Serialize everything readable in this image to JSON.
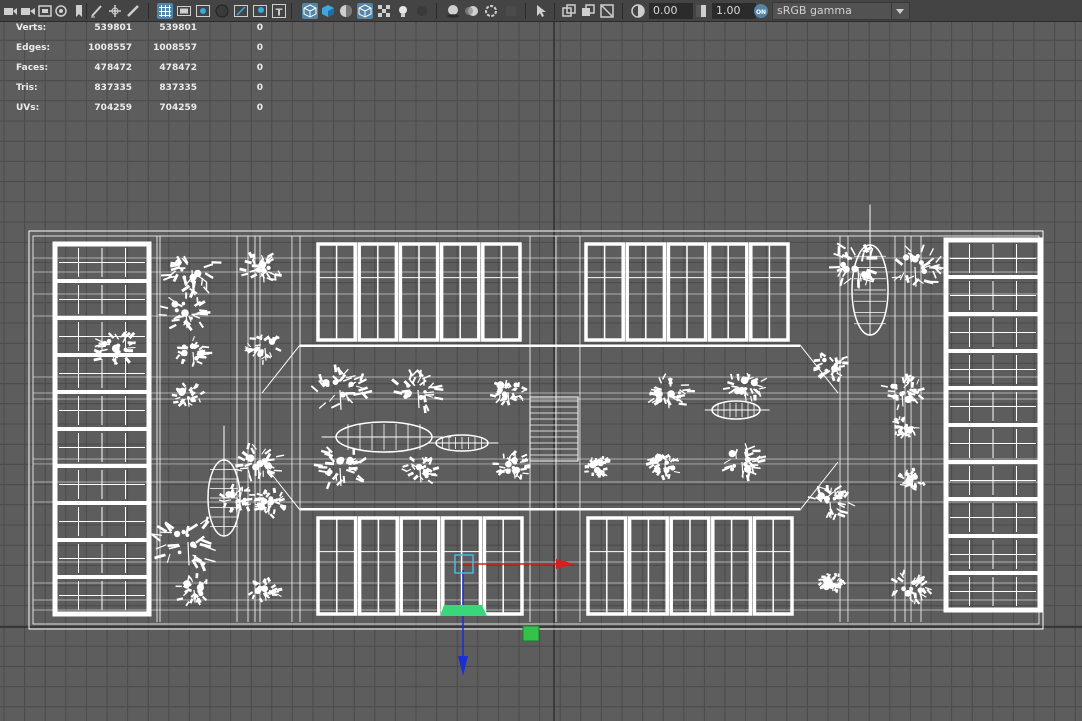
{
  "toolbar": {
    "colorspace_label": "sRGB gamma",
    "exposure_value": "0.00",
    "gamma_value": "1.00",
    "colors": {
      "accent": "#5285a6",
      "bg": "#444444",
      "icon": "#cfcfcf"
    }
  },
  "hud": {
    "rows": [
      {
        "label": "Verts:",
        "scene": "539801",
        "selected": "539801",
        "extra": "0"
      },
      {
        "label": "Edges:",
        "scene": "1008557",
        "selected": "1008557",
        "extra": "0"
      },
      {
        "label": "Faces:",
        "scene": "478472",
        "selected": "478472",
        "extra": "0"
      },
      {
        "label": "Tris:",
        "scene": "837335",
        "selected": "837335",
        "extra": "0"
      },
      {
        "label": "UVs:",
        "scene": "704259",
        "selected": "704259",
        "extra": "0"
      }
    ]
  },
  "viewport": {
    "background": "#5d5d5d",
    "grid_color": "#4a4a4a",
    "axis_line_color": "#2f2f2f",
    "wireframe_color": "#ffffff",
    "manipulator": {
      "x_axis": "#d42020",
      "y_axis": "#1a2fd0",
      "plane": "#39d77a",
      "handle": "#35c24a"
    }
  }
}
